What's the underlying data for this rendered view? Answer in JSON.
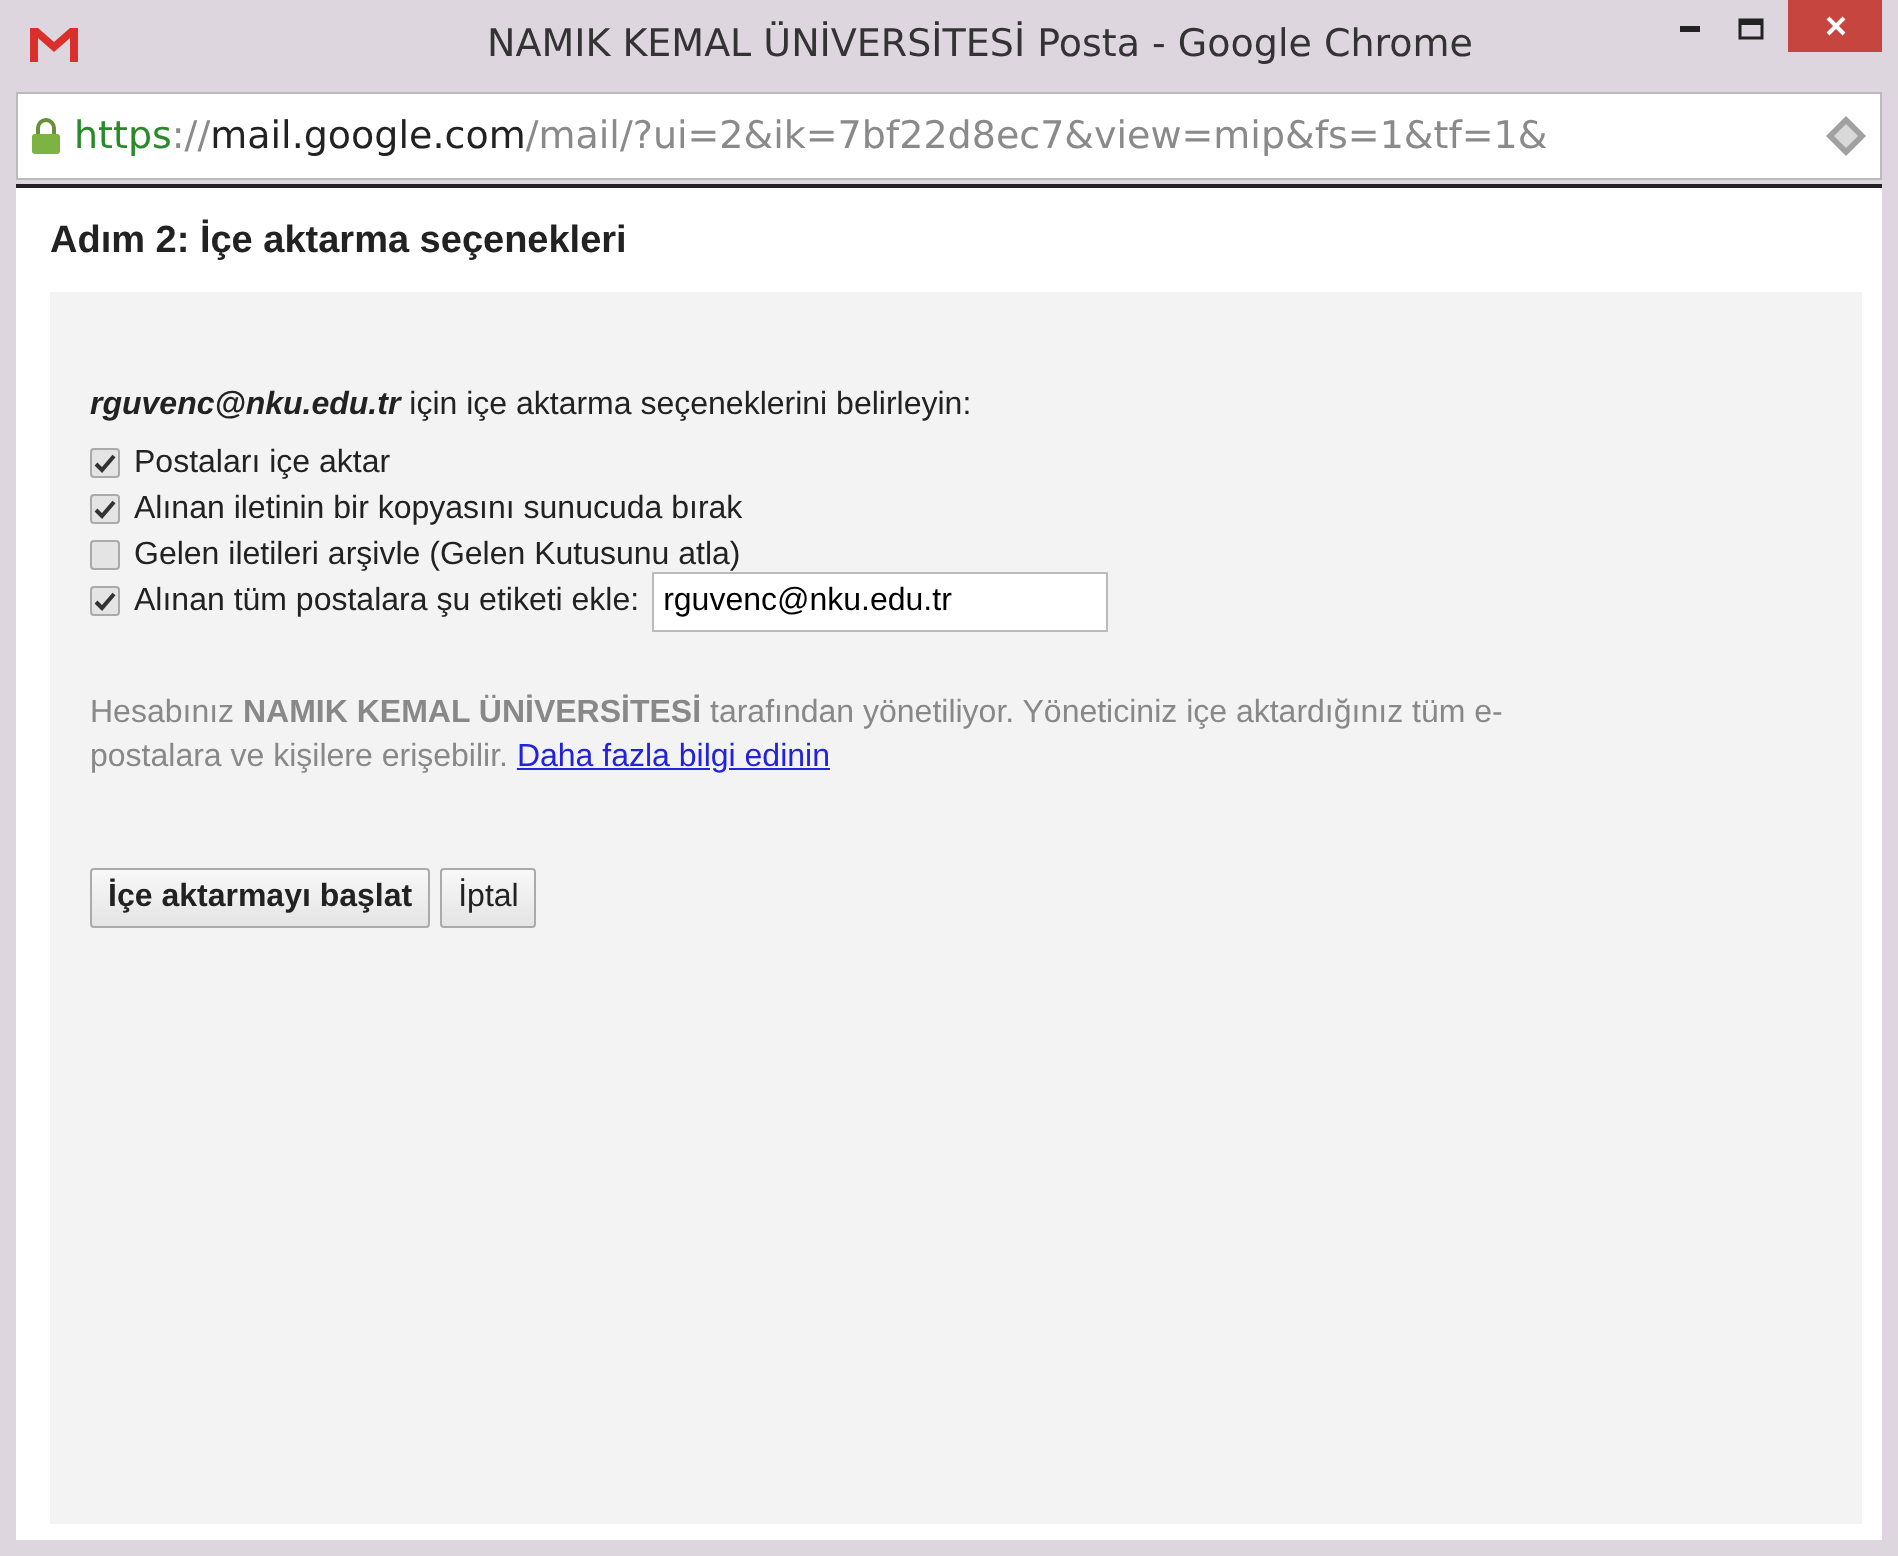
{
  "window": {
    "title": "NAMIK KEMAL ÜNİVERSİTESİ Posta - Google Chrome"
  },
  "address": {
    "scheme": "https",
    "separator": "://",
    "host": "mail.google.com",
    "path": "/mail/?ui=2&ik=7bf22d8ec7&view=mip&fs=1&tf=1&"
  },
  "heading": "Adım 2: İçe aktarma seçenekleri",
  "intro": "**rguvenc@nku.edu.tr** için içe aktarma seçeneklerini belirleyin:",
  "options": [
    {
      "kind": "plain",
      "label": "Postaları içe aktar",
      "checked": true
    },
    {
      "kind": "plain",
      "label": "Alınan iletinin bir kopyasını sunucuda bırak",
      "checked": true
    },
    {
      "kind": "plain",
      "label": "Gelen iletileri arşivle (Gelen Kutusunu atla)",
      "checked": false
    },
    {
      "kind": "text-input",
      "label": "Alınan tüm postalara şu etiketi ekle:",
      "checked": true,
      "value": "rguvenc@nku.edu.tr"
    }
  ],
  "notice": "Hesabınız **NAMIK KEMAL ÜNİVERSİTESİ** tarafından yönetiliyor. Yöneticiniz içe aktardığınız tüm e-postalara ve kişilere erişebilir.",
  "notice_link": "Daha fazla bilgi edinin",
  "buttons": [
    {
      "kind": "primary",
      "label": "İçe aktarmayı başlat"
    },
    {
      "kind": "plain",
      "label": "İptal"
    }
  ]
}
